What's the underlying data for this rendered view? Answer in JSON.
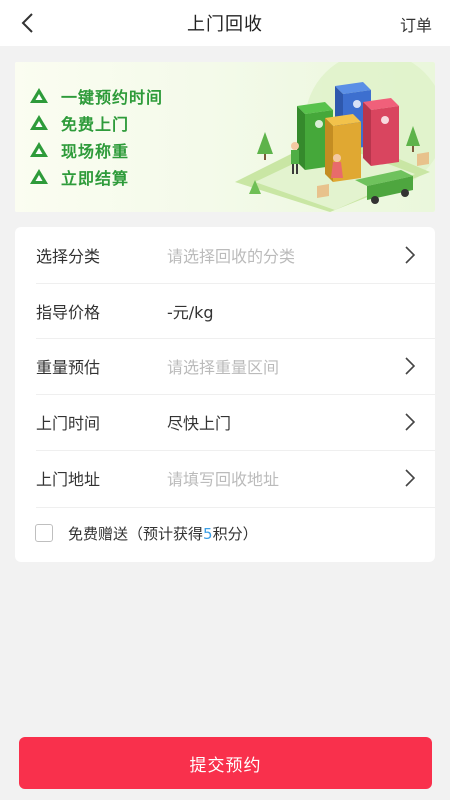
{
  "nav": {
    "title": "上门回收",
    "right_label": "订单"
  },
  "banner": {
    "slogans": [
      "一键预约时间",
      "免费上门",
      "现场称重",
      "立即结算"
    ],
    "accent": "#2e9b3a"
  },
  "form": {
    "rows": [
      {
        "label": "选择分类",
        "value": "请选择回收的分类",
        "placeholder": true,
        "arrow": true
      },
      {
        "label": "指导价格",
        "value": "-元/kg",
        "placeholder": false,
        "arrow": false
      },
      {
        "label": "重量预估",
        "value": "请选择重量区间",
        "placeholder": true,
        "arrow": true
      },
      {
        "label": "上门时间",
        "value": "尽快上门",
        "placeholder": false,
        "arrow": true
      },
      {
        "label": "上门地址",
        "value": "请填写回收地址",
        "placeholder": true,
        "arrow": true
      }
    ],
    "gift": {
      "prefix": "免费赠送（预计获得",
      "points": "5",
      "suffix": "积分）",
      "checked": false
    }
  },
  "submit_label": "提交预约",
  "colors": {
    "primary": "#f9304c",
    "points": "#3c9fe6",
    "placeholder": "#bbbbbb"
  }
}
